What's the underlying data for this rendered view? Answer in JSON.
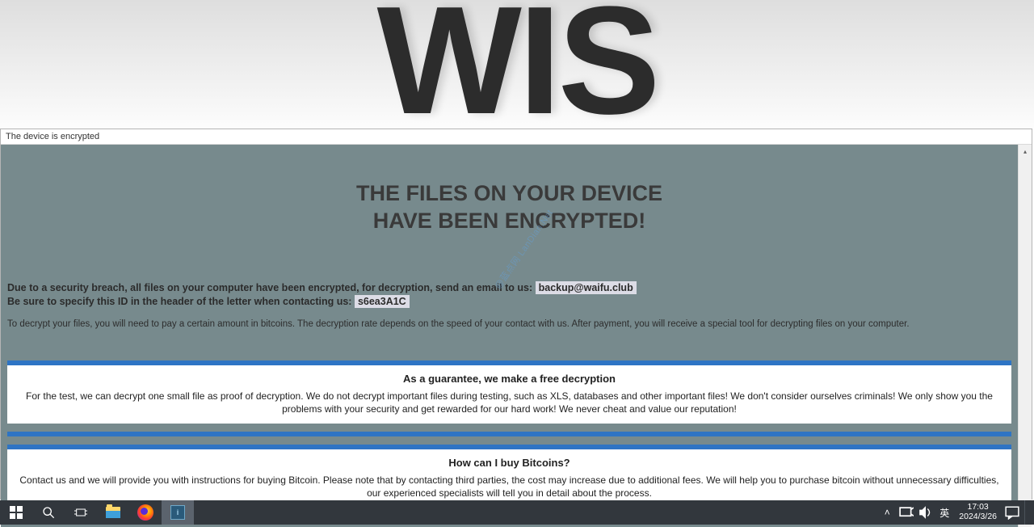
{
  "wallpaper": {
    "brand": "WIS"
  },
  "window": {
    "title": "The device is encrypted",
    "heading_line1": "THE FILES ON YOUR DEVICE",
    "heading_line2": "HAVE BEEN ENCRYPTED!",
    "intro1_a": "Due to a security breach, all files on your computer have been encrypted, for decryption, send an email to us: ",
    "intro1_email": "backup@waifu.club",
    "intro2_a": "Be sure to specify this ID in the header of the letter when contacting us: ",
    "intro2_id": "s6ea3A1C",
    "para": "To decrypt your files, you will need to pay a certain amount in bitcoins. The decryption rate depends on the speed of your contact with us. After payment, you will receive a special tool for decrypting files on your computer.",
    "panel1": {
      "title": "As a guarantee, we make a free decryption",
      "body": "For the test, we can decrypt one small file as proof of decryption. We do not decrypt important files during testing, such as XLS, databases and other important files! We don't consider ourselves criminals! We only show you the problems with your security and get rewarded for our hard work! We never cheat and value our reputation!"
    },
    "panel2": {
      "title": "How can I buy Bitcoins?",
      "body": "Contact us and we will provide you with instructions for buying Bitcoin. Please note that by contacting third parties, the cost may increase due to additional fees. We will help you to purchase bitcoin without unnecessary difficulties, our experienced specialists will tell you in detail about the process."
    }
  },
  "watermark": "@蓝点网 LanDian.Net",
  "taskbar": {
    "ime": "英",
    "time": "17:03",
    "date": "2024/3/26"
  }
}
